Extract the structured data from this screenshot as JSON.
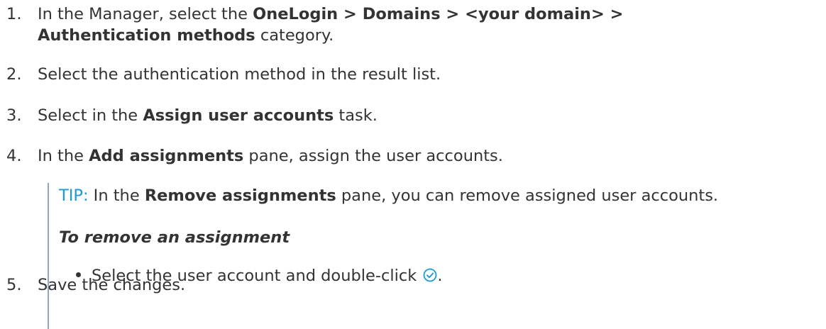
{
  "steps": [
    {
      "number": "1.",
      "line1_prefix": "In the Manager, select the ",
      "line1_bold": "OneLogin > Domains > <your domain> >",
      "line2_bold": "Authentication methods",
      "line2_suffix": " category."
    },
    {
      "number": "2.",
      "text": "Select the authentication method in the result list."
    },
    {
      "number": "3.",
      "prefix": "Select in the ",
      "bold": "Assign user accounts",
      "suffix": " task."
    },
    {
      "number": "4.",
      "prefix": "In the ",
      "bold": "Add assignments",
      "suffix": " pane, assign the user accounts."
    },
    {
      "number": "5.",
      "text": "Save the changes."
    }
  ],
  "tip": {
    "label": "TIP:",
    "prefix": " In the ",
    "bold": "Remove assignments",
    "suffix": " pane, you can remove assigned user accounts.",
    "heading": "To remove an assignment",
    "bullet_text": "Select the user account and double-click ",
    "bullet_end": ".",
    "icon": "checkmark-circle-icon",
    "icon_color": "#1a9ad6"
  }
}
